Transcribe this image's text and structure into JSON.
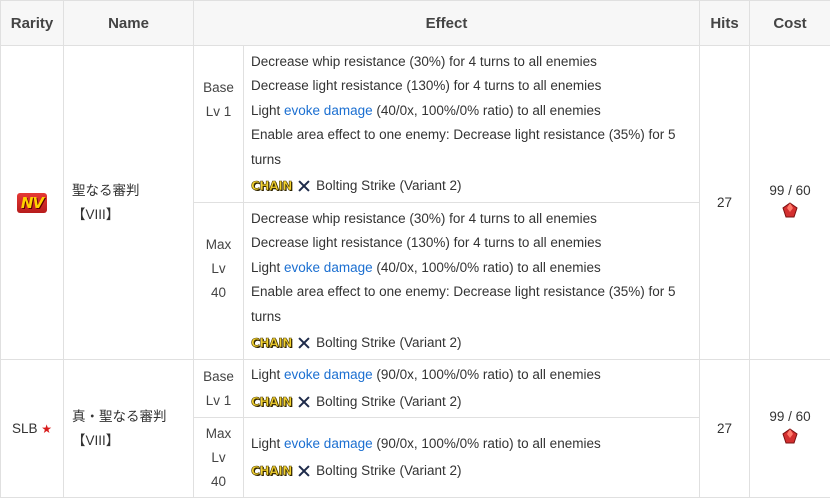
{
  "headers": {
    "rarity": "Rarity",
    "name": "Name",
    "effect": "Effect",
    "hits": "Hits",
    "cost": "Cost"
  },
  "rows": [
    {
      "rarity_badge": "NV",
      "name_line1": "聖なる審判",
      "name_line2": "【VIII】",
      "hits": "27",
      "cost": "99 / 60",
      "levels": [
        {
          "level_line1": "Base",
          "level_line2": "Lv 1",
          "effects": [
            "Decrease whip resistance (30%) for 4 turns to all enemies",
            "Decrease light resistance (130%) for 4 turns to all enemies"
          ],
          "evoke_prefix": "Light ",
          "evoke_link": "evoke damage",
          "evoke_suffix": " (40/0x, 100%/0% ratio) to all enemies",
          "area_effect": "Enable area effect to one enemy: Decrease light resistance (35%) for 5 turns",
          "chain_logo": "CHAIN",
          "chain_text": "Bolting Strike (Variant 2)"
        },
        {
          "level_line1": "Max",
          "level_line2": "Lv",
          "level_line3": "40",
          "effects": [
            "Decrease whip resistance (30%) for 4 turns to all enemies",
            "Decrease light resistance (130%) for 4 turns to all enemies"
          ],
          "evoke_prefix": "Light ",
          "evoke_link": "evoke damage",
          "evoke_suffix": " (40/0x, 100%/0% ratio) to all enemies",
          "area_effect": "Enable area effect to one enemy: Decrease light resistance (35%) for 5 turns",
          "chain_logo": "CHAIN",
          "chain_text": "Bolting Strike (Variant 2)"
        }
      ]
    },
    {
      "rarity_text": "SLB",
      "rarity_star": "★",
      "name_line1": "真・聖なる審判",
      "name_line2": "【VIII】",
      "hits": "27",
      "cost": "99 / 60",
      "levels": [
        {
          "level_line1": "Base",
          "level_line2": "Lv 1",
          "evoke_prefix": "Light ",
          "evoke_link": "evoke damage",
          "evoke_suffix": " (90/0x, 100%/0% ratio) to all enemies",
          "chain_logo": "CHAIN",
          "chain_text": "Bolting Strike (Variant 2)"
        },
        {
          "level_line1": "Max",
          "level_line2": "Lv",
          "level_line3": "40",
          "evoke_prefix": "Light ",
          "evoke_link": "evoke damage",
          "evoke_suffix": " (90/0x, 100%/0% ratio) to all enemies",
          "chain_logo": "CHAIN",
          "chain_text": "Bolting Strike (Variant 2)"
        }
      ]
    }
  ],
  "colors": {
    "link": "#1b6fd1",
    "header_bg": "#f7f7f7",
    "border": "#e0e0e0",
    "star": "#d81b1b"
  },
  "icons": {
    "cost_icon": "red-gem-icon",
    "chain_icon": "chain-cross-icon"
  }
}
